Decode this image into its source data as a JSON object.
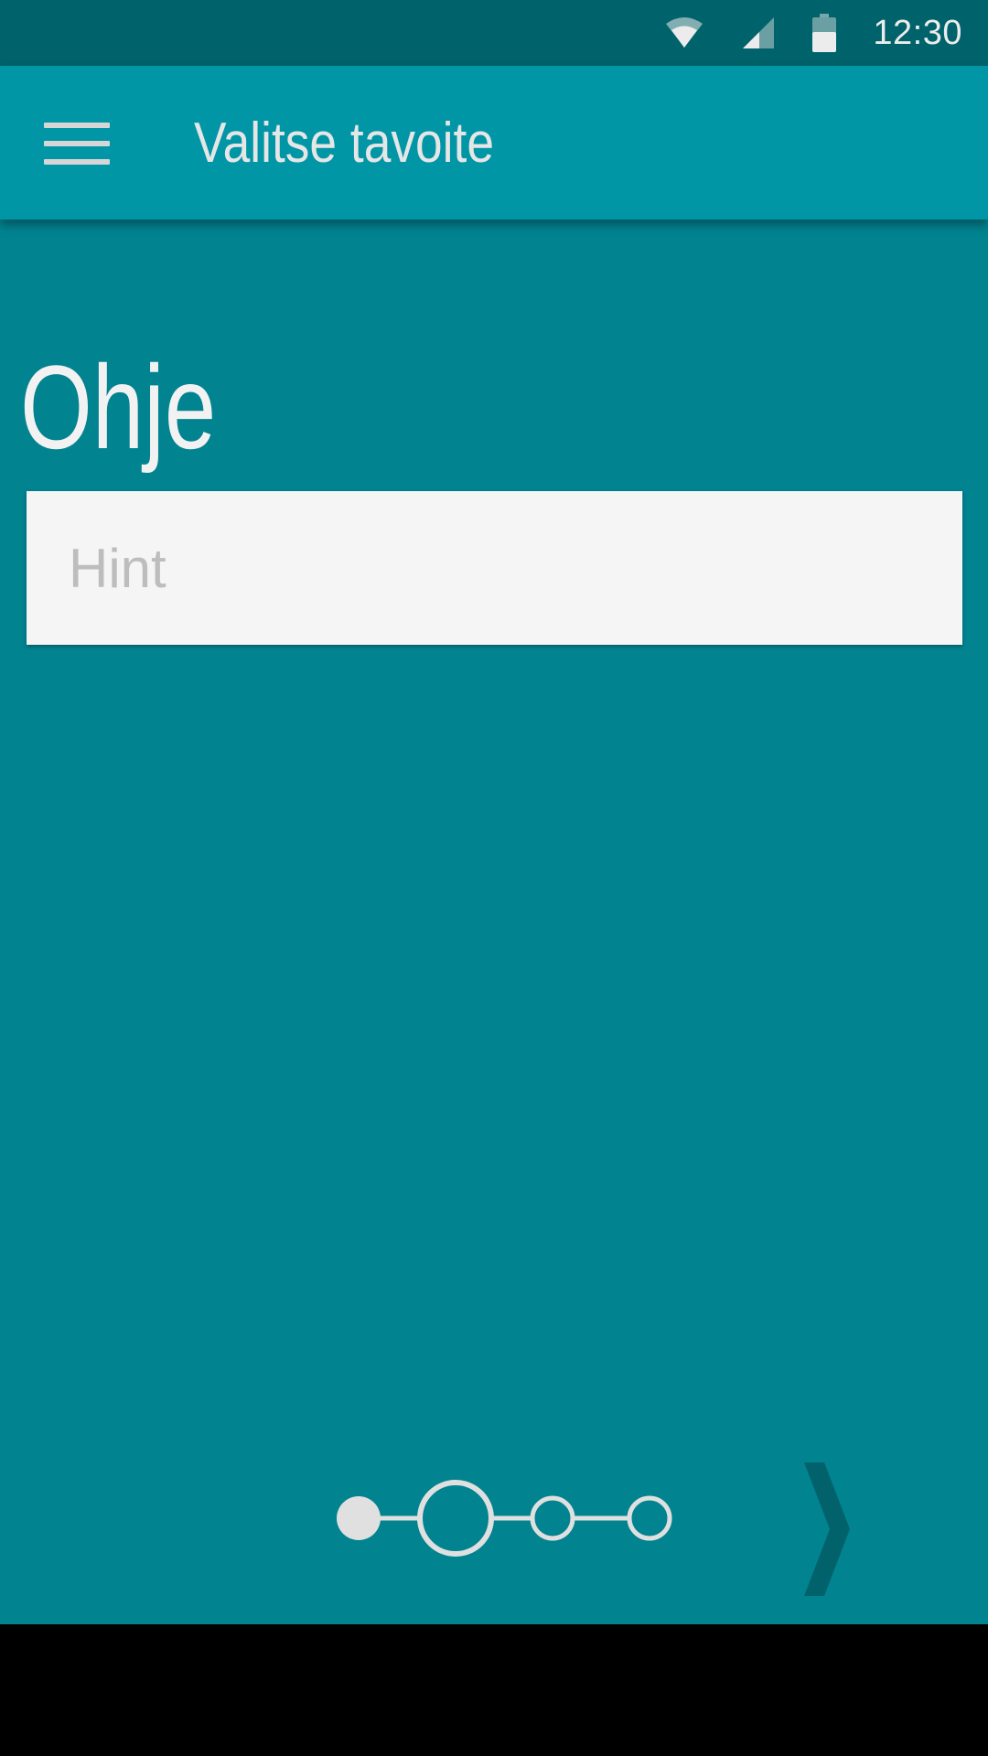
{
  "status_bar": {
    "time": "12:30",
    "icons": [
      "wifi-icon",
      "cellular-signal-icon",
      "battery-icon"
    ]
  },
  "app_bar": {
    "menu_icon": "hamburger-menu-icon",
    "title": "Valitse tavoite"
  },
  "content": {
    "heading": "Ohje",
    "input": {
      "placeholder": "Hint",
      "value": ""
    }
  },
  "pager": {
    "total_steps": 4,
    "current_step": 1,
    "next_icon": "chevron-right-icon"
  },
  "colors": {
    "status_bar": "#00626A",
    "app_bar": "#0096A6",
    "background": "#028390",
    "card": "#F5F5F5",
    "text_light": "#E6E6E6",
    "chevron": "#02626C"
  }
}
